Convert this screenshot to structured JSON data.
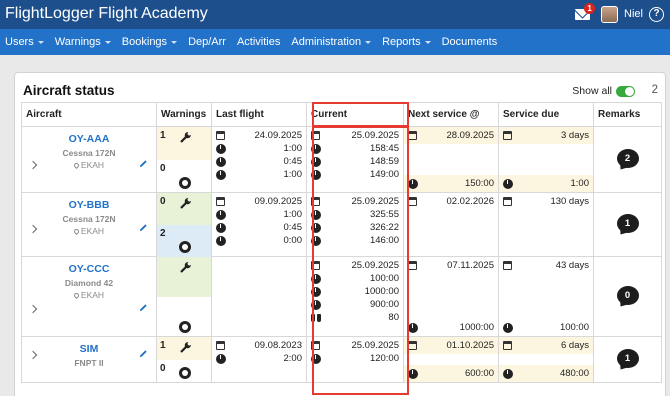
{
  "app": {
    "title": "FlightLogger Flight Academy",
    "user_name": "Niel",
    "mail_badge": "1",
    "help_symbol": "?"
  },
  "nav": [
    "Users",
    "Warnings",
    "Bookings",
    "Dep/Arr",
    "Activities",
    "Administration",
    "Reports",
    "Documents"
  ],
  "nav_dropdown": [
    true,
    true,
    true,
    false,
    false,
    true,
    true,
    false
  ],
  "panel": {
    "title": "Aircraft status",
    "show_all_label": "Show all",
    "show_all_on": true,
    "count": "2"
  },
  "columns": [
    "Aircraft",
    "Warnings",
    "Last flight",
    "Current",
    "Next service @",
    "Service due",
    "Remarks"
  ],
  "rows": [
    {
      "registration": "OY-AAA",
      "type": "Cessna 172N",
      "base": "EKAH",
      "warnings": [
        {
          "count": "1",
          "kind": "wrench"
        },
        {
          "count": "0",
          "kind": "tire"
        }
      ],
      "last_flight": {
        "date": "24.09.2025",
        "values": [
          "1:00",
          "0:45",
          "1:00"
        ]
      },
      "current": {
        "date": "25.09.2025",
        "values": [
          "158:45",
          "148:59",
          "149:00"
        ]
      },
      "next_service": {
        "date": "28.09.2025",
        "hours": "150:00"
      },
      "service_due": {
        "days": "3 days",
        "hours": "1:00"
      },
      "remarks": "2"
    },
    {
      "registration": "OY-BBB",
      "type": "Cessna 172N",
      "base": "EKAH",
      "warnings": [
        {
          "count": "0",
          "kind": "wrench"
        },
        {
          "count": "2",
          "kind": "tire"
        }
      ],
      "last_flight": {
        "date": "09.09.2025",
        "values": [
          "1:00",
          "0:45",
          "0:00"
        ]
      },
      "current": {
        "date": "25.09.2025",
        "values": [
          "325:55",
          "326:22",
          "146:00"
        ]
      },
      "next_service": {
        "date": "02.02.2026",
        "hours": ""
      },
      "service_due": {
        "days": "130 days",
        "hours": ""
      },
      "remarks": "1"
    },
    {
      "registration": "OY-CCC",
      "type": "Diamond 42",
      "base": "EKAH",
      "warnings": [
        {
          "count": "",
          "kind": "wrench"
        },
        {
          "count": "",
          "kind": "tire"
        }
      ],
      "last_flight": {
        "date": "",
        "values": []
      },
      "current": {
        "date": "25.09.2025",
        "values": [
          "100:00",
          "1000:00",
          "900:00",
          "80"
        ]
      },
      "next_service": {
        "date": "07.11.2025",
        "hours": "1000:00"
      },
      "service_due": {
        "days": "43 days",
        "hours": "100:00"
      },
      "remarks": "0"
    },
    {
      "registration": "SIM",
      "type": "FNPT II",
      "base": "",
      "warnings": [
        {
          "count": "1",
          "kind": "wrench"
        },
        {
          "count": "0",
          "kind": "tire"
        }
      ],
      "last_flight": {
        "date": "09.08.2023",
        "values": [
          "2:00"
        ]
      },
      "current": {
        "date": "25.09.2025",
        "values": [
          "120:00"
        ]
      },
      "next_service": {
        "date": "01.10.2025",
        "hours": "600:00"
      },
      "service_due": {
        "days": "6 days",
        "hours": "480:00"
      },
      "remarks": "1"
    }
  ],
  "colors": {
    "topbar": "#1c4f8c",
    "navbar": "#2272c9",
    "link": "#2272c9",
    "highlight_border": "#e53b31",
    "warning_yellow": "#fcf5df",
    "warning_green": "#e7f2d6",
    "warning_blue": "#dcebf6",
    "toggle_on": "#37a93d"
  }
}
